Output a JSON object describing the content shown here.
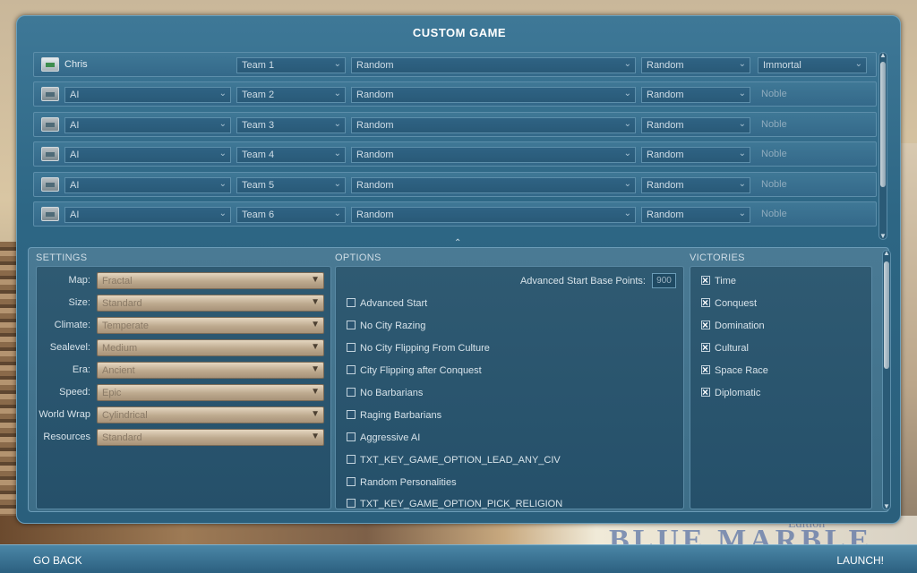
{
  "background": {
    "watermark": "BLUE MARBLE",
    "watermark_sub": "Edition"
  },
  "dialog": {
    "title": "CUSTOM GAME"
  },
  "players": [
    {
      "name": "Chris",
      "team": "Team 1",
      "civ": "Random",
      "leader": "Random",
      "difficulty": "Immortal",
      "human": true
    },
    {
      "name": "AI",
      "team": "Team 2",
      "civ": "Random",
      "leader": "Random",
      "difficulty": "Noble",
      "human": false
    },
    {
      "name": "AI",
      "team": "Team 3",
      "civ": "Random",
      "leader": "Random",
      "difficulty": "Noble",
      "human": false
    },
    {
      "name": "AI",
      "team": "Team 4",
      "civ": "Random",
      "leader": "Random",
      "difficulty": "Noble",
      "human": false
    },
    {
      "name": "AI",
      "team": "Team 5",
      "civ": "Random",
      "leader": "Random",
      "difficulty": "Noble",
      "human": false
    },
    {
      "name": "AI",
      "team": "Team 6",
      "civ": "Random",
      "leader": "Random",
      "difficulty": "Noble",
      "human": false
    }
  ],
  "settings": {
    "title": "SETTINGS",
    "items": [
      {
        "label": "Map:",
        "value": "Fractal"
      },
      {
        "label": "Size:",
        "value": "Standard"
      },
      {
        "label": "Climate:",
        "value": "Temperate"
      },
      {
        "label": "Sealevel:",
        "value": "Medium"
      },
      {
        "label": "Era:",
        "value": "Ancient"
      },
      {
        "label": "Speed:",
        "value": "Epic"
      },
      {
        "label": "World Wrap",
        "value": "Cylindrical"
      },
      {
        "label": "Resources",
        "value": "Standard"
      }
    ]
  },
  "options": {
    "title": "OPTIONS",
    "advanced_start_label": "Advanced Start Base Points:",
    "advanced_start_value": "900",
    "items": [
      {
        "label": "Advanced Start",
        "checked": false
      },
      {
        "label": "No City Razing",
        "checked": false
      },
      {
        "label": "No City Flipping From Culture",
        "checked": false
      },
      {
        "label": "City Flipping after Conquest",
        "checked": false
      },
      {
        "label": "No Barbarians",
        "checked": false
      },
      {
        "label": "Raging Barbarians",
        "checked": false
      },
      {
        "label": "Aggressive AI",
        "checked": false
      },
      {
        "label": "TXT_KEY_GAME_OPTION_LEAD_ANY_CIV",
        "checked": false
      },
      {
        "label": "Random Personalities",
        "checked": false
      },
      {
        "label": "TXT_KEY_GAME_OPTION_PICK_RELIGION",
        "checked": false
      }
    ]
  },
  "victories": {
    "title": "VICTORIES",
    "items": [
      {
        "label": "Time",
        "checked": true
      },
      {
        "label": "Conquest",
        "checked": true
      },
      {
        "label": "Domination",
        "checked": true
      },
      {
        "label": "Cultural",
        "checked": true
      },
      {
        "label": "Space Race",
        "checked": true
      },
      {
        "label": "Diplomatic",
        "checked": true
      }
    ]
  },
  "footer": {
    "back_label": "GO BACK",
    "launch_label": "LAUNCH!"
  },
  "icons": {
    "dropdown": "chevron-down-icon",
    "collapse": "chevron-up-icon",
    "player": "player-slot-icon"
  }
}
